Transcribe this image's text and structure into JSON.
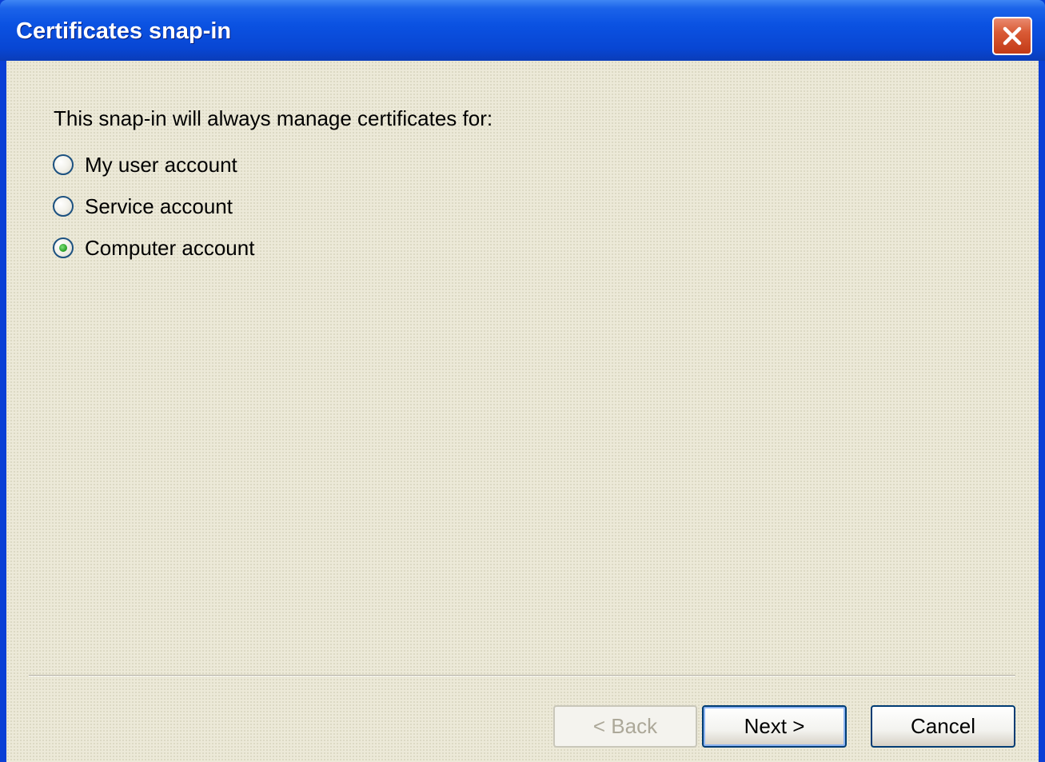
{
  "window": {
    "title": "Certificates snap-in"
  },
  "dialog": {
    "prompt": "This snap-in will always manage certificates for:",
    "options": [
      {
        "label": "My user account",
        "selected": false
      },
      {
        "label": "Service account",
        "selected": false
      },
      {
        "label": "Computer account",
        "selected": true
      }
    ]
  },
  "buttons": {
    "back_label": "< Back",
    "back_enabled": false,
    "next_label": "Next >",
    "cancel_label": "Cancel"
  },
  "icons": {
    "close": "close-icon"
  },
  "colors": {
    "titlebar": "#0b52e2",
    "close_button": "#d95a35",
    "dialog_background": "#ece9d8",
    "selected_radio": "#2fa52c"
  }
}
